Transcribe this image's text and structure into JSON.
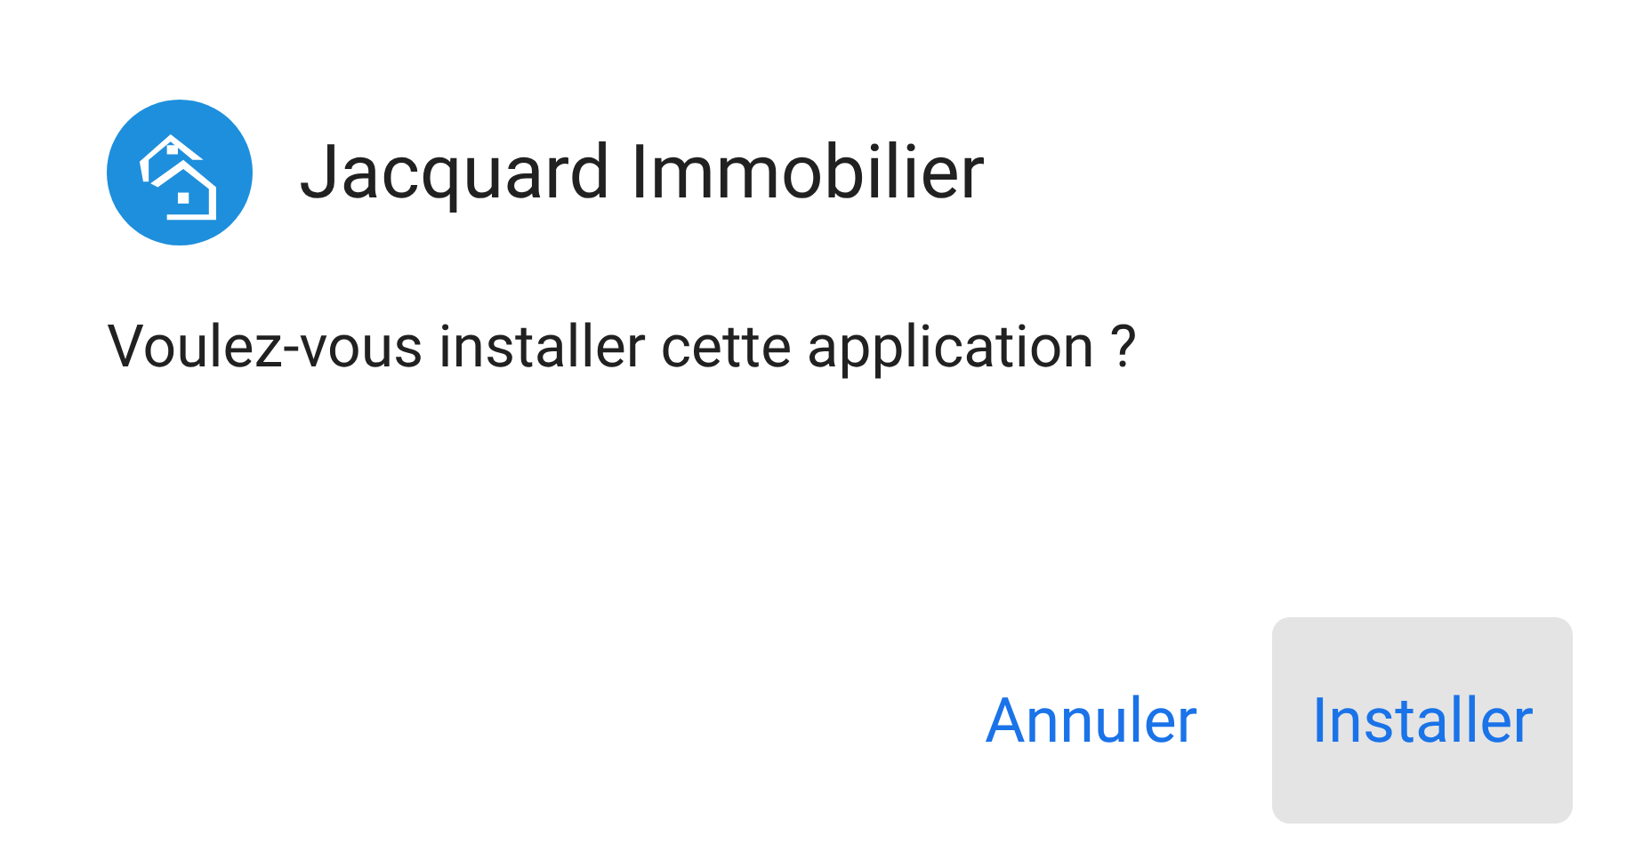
{
  "dialog": {
    "app_name": "Jacquard Immobilier",
    "message": "Voulez-vous installer cette application ?",
    "buttons": [
      {
        "label": "Annuler",
        "focused": false
      },
      {
        "label": "Installer",
        "focused": true
      }
    ]
  }
}
